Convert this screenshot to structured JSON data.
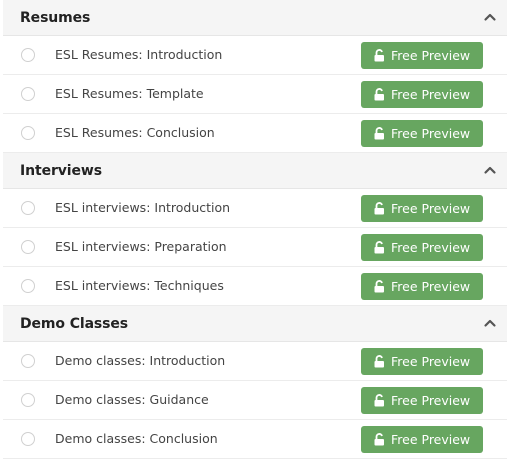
{
  "sections": [
    {
      "title": "Resumes",
      "collapse_icon": "chevron-up-icon",
      "lessons": [
        {
          "label": "ESL Resumes: Introduction",
          "button": "Free Preview"
        },
        {
          "label": "ESL Resumes: Template",
          "button": "Free Preview"
        },
        {
          "label": "ESL Resumes: Conclusion",
          "button": "Free Preview"
        }
      ]
    },
    {
      "title": "Interviews",
      "collapse_icon": "chevron-up-icon",
      "lessons": [
        {
          "label": "ESL interviews: Introduction",
          "button": "Free Preview"
        },
        {
          "label": "ESL interviews: Preparation",
          "button": "Free Preview"
        },
        {
          "label": "ESL interviews: Techniques",
          "button": "Free Preview"
        }
      ]
    },
    {
      "title": "Demo Classes",
      "collapse_icon": "chevron-up-icon",
      "lessons": [
        {
          "label": "Demo classes: Introduction",
          "button": "Free Preview"
        },
        {
          "label": "Demo classes: Guidance",
          "button": "Free Preview"
        },
        {
          "label": "Demo classes: Conclusion",
          "button": "Free Preview"
        }
      ]
    }
  ],
  "colors": {
    "button": "#67a660",
    "header_bg": "#f5f5f5"
  },
  "button_icon": "unlock-icon"
}
